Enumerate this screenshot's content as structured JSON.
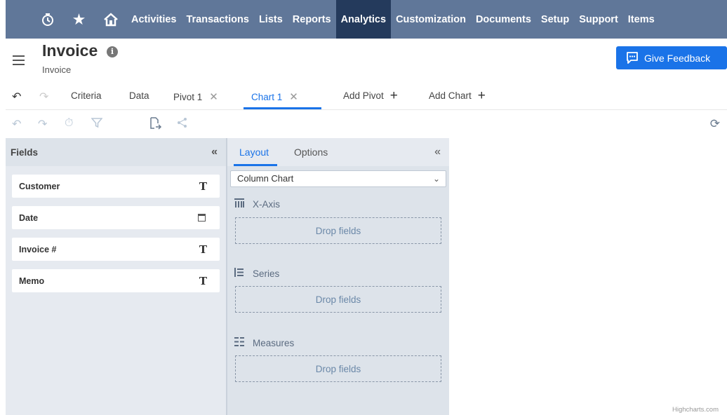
{
  "nav": {
    "icons": [
      "recent-icon",
      "star-icon",
      "home-icon"
    ],
    "items": [
      "Activities",
      "Transactions",
      "Lists",
      "Reports",
      "Analytics",
      "Customization",
      "Documents",
      "Setup",
      "Support",
      "Items"
    ],
    "active": "Analytics"
  },
  "header": {
    "title": "Invoice",
    "subtitle": "Invoice",
    "feedback_label": "Give Feedback"
  },
  "tabs": {
    "criteria": "Criteria",
    "data": "Data",
    "pivot": "Pivot 1",
    "chart": "Chart 1",
    "add_pivot": "Add Pivot",
    "add_chart": "Add Chart"
  },
  "fields_panel": {
    "title": "Fields",
    "fields": [
      {
        "label": "Customer",
        "type": "T"
      },
      {
        "label": "Date",
        "type": "date"
      },
      {
        "label": "Invoice #",
        "type": "T"
      },
      {
        "label": "Memo",
        "type": "T"
      }
    ]
  },
  "layout_panel": {
    "tab_layout": "Layout",
    "tab_options": "Options",
    "chart_type": "Column Chart",
    "x_axis_label": "X-Axis",
    "series_label": "Series",
    "measures_label": "Measures",
    "drop_placeholder": "Drop fields"
  },
  "canvas": {
    "credit": "Highcharts.com"
  },
  "colors": {
    "nav_bg": "#607799",
    "nav_active": "#243a5c",
    "accent": "#1a73e8"
  }
}
